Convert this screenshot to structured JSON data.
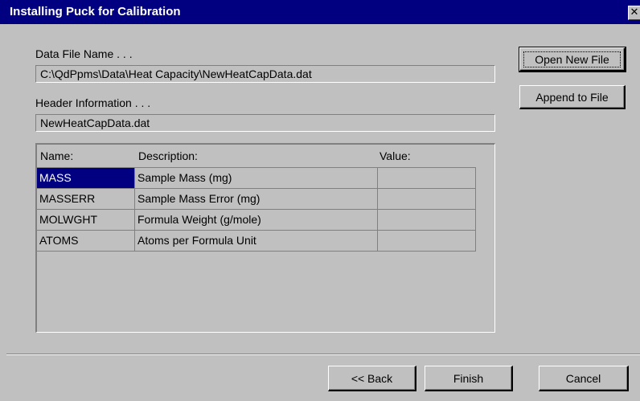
{
  "window": {
    "title": "Installing Puck for Calibration",
    "close_glyph": "✕"
  },
  "data_file": {
    "label": "Data File Name . . .",
    "value": "C:\\QdPpms\\Data\\Heat Capacity\\NewHeatCapData.dat"
  },
  "header_info": {
    "label": "Header Information . . .",
    "value": "NewHeatCapData.dat"
  },
  "buttons": {
    "open_new_file": "Open New File",
    "append_to_file": "Append to File",
    "back": "<< Back",
    "finish": "Finish",
    "cancel": "Cancel"
  },
  "grid": {
    "columns": [
      "Name:",
      "Description:",
      "Value:"
    ],
    "rows": [
      {
        "name": "MASS",
        "description": "Sample Mass (mg)",
        "value": "",
        "selected": true
      },
      {
        "name": "MASSERR",
        "description": "Sample Mass Error (mg)",
        "value": "",
        "selected": false
      },
      {
        "name": "MOLWGHT",
        "description": "Formula Weight (g/mole)",
        "value": "",
        "selected": false
      },
      {
        "name": "ATOMS",
        "description": "Atoms per Formula Unit",
        "value": "",
        "selected": false
      }
    ]
  },
  "colors": {
    "title_bar": "#000080",
    "face": "#c0c0c0",
    "selection": "#000080"
  }
}
